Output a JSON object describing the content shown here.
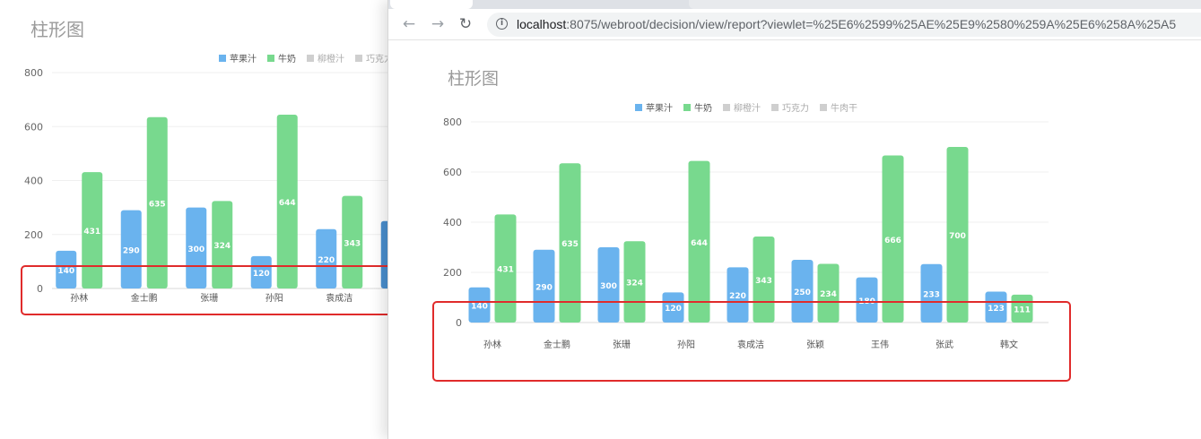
{
  "browser": {
    "url_host": "localhost",
    "url_rest": ":8075/webroot/decision/view/report?viewlet=%25E6%2599%25AE%25E9%2580%259A%25E6%258A%25A5"
  },
  "icons": {
    "back": "arrow-left-icon",
    "forward": "arrow-right-icon",
    "reload": "reload-icon",
    "info": "info-icon"
  },
  "colors": {
    "apple_juice": "#6ab3ee",
    "milk": "#78d98e",
    "inactive_legend": "#cfcfcf",
    "highlight": "#e02b2b",
    "partial_bar": "#4a8fcf"
  },
  "back_chart": {
    "title": "柱形图",
    "legend": [
      "苹果汁",
      "牛奶",
      "柳橙汁",
      "巧克力"
    ]
  },
  "chart_data": [
    {
      "type": "bar",
      "title": "柱形图",
      "legend": [
        {
          "name": "苹果汁",
          "active": true
        },
        {
          "name": "牛奶",
          "active": true
        },
        {
          "name": "柳橙汁",
          "active": false
        },
        {
          "name": "巧克力",
          "active": false
        },
        {
          "name": "牛肉干",
          "active": false
        }
      ],
      "categories": [
        "孙林",
        "金士鹏",
        "张珊",
        "孙阳",
        "袁成洁",
        "张颖",
        "王伟",
        "张武",
        "韩文"
      ],
      "series": [
        {
          "name": "苹果汁",
          "values": [
            140,
            290,
            300,
            120,
            220,
            250,
            180,
            233,
            123
          ]
        },
        {
          "name": "牛奶",
          "values": [
            431,
            635,
            324,
            644,
            343,
            234,
            666,
            700,
            111
          ]
        }
      ],
      "yticks": [
        0,
        200,
        400,
        600,
        800
      ],
      "ylim": [
        0,
        800
      ],
      "grid": true,
      "legend_position": "top-center"
    }
  ]
}
